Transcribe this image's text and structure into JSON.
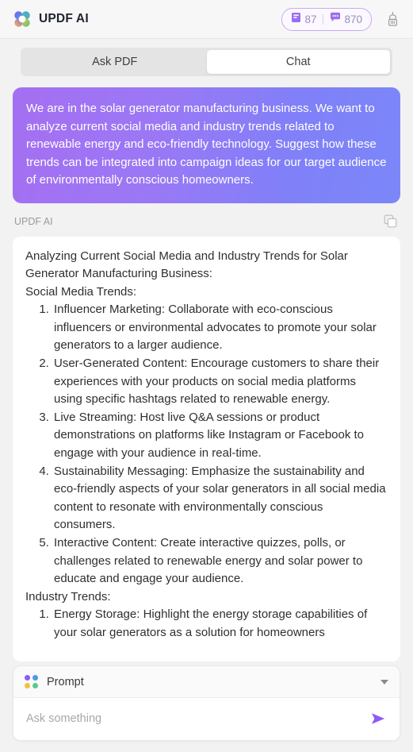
{
  "header": {
    "brand_title": "UPDF AI",
    "logo_icon": "updf-clover-logo",
    "credits": {
      "pages_icon": "document-pages-icon",
      "pages_value": "87",
      "messages_icon": "chat-bubble-icon",
      "messages_value": "870"
    },
    "clear_icon": "brush-clear-icon",
    "accent_color": "#8b5cf6",
    "credit_border_color": "#c9a9f5"
  },
  "tabs": {
    "items": [
      {
        "label": "Ask PDF",
        "active": false
      },
      {
        "label": "Chat",
        "active": true
      }
    ]
  },
  "conversation": {
    "user_message": "We are in the solar generator manufacturing business. We want to analyze current social media and industry trends related to renewable energy and eco-friendly technology. Suggest how these trends can be integrated into campaign ideas for our target audience of environmentally conscious homeowners.",
    "bubble_gradient_from": "#a56ff2",
    "bubble_gradient_to": "#7b87f9",
    "answer_author": "UPDF AI",
    "copy_icon": "copy-icon",
    "answer": {
      "heading": "Analyzing Current Social Media and Industry Trends for Solar Generator Manufacturing Business:",
      "section_1_title": "Social Media Trends:",
      "section_1_items": [
        "Influencer Marketing: Collaborate with eco-conscious influencers or environmental advocates to promote your solar generators to a larger audience.",
        "User-Generated Content: Encourage customers to share their experiences with your products on social media platforms using specific hashtags related to renewable energy.",
        "Live Streaming: Host live Q&A sessions or product demonstrations on platforms like Instagram or Facebook to engage with your audience in real-time.",
        "Sustainability Messaging: Emphasize the sustainability and eco-friendly aspects of your solar generators in all social media content to resonate with environmentally conscious consumers.",
        "Interactive Content: Create interactive quizzes, polls, or challenges related to renewable energy and solar power to educate and engage your audience."
      ],
      "section_2_title": "Industry Trends:",
      "section_2_items": [
        "Energy Storage: Highlight the energy storage capabilities of your solar generators as a solution for homeowners"
      ]
    }
  },
  "composer": {
    "prompt_label": "Prompt",
    "prompt_icon": "four-dot-grid-icon",
    "chevron_icon": "chevron-down-icon",
    "input_value": "",
    "input_placeholder": "Ask something",
    "send_icon": "send-arrow-icon"
  }
}
